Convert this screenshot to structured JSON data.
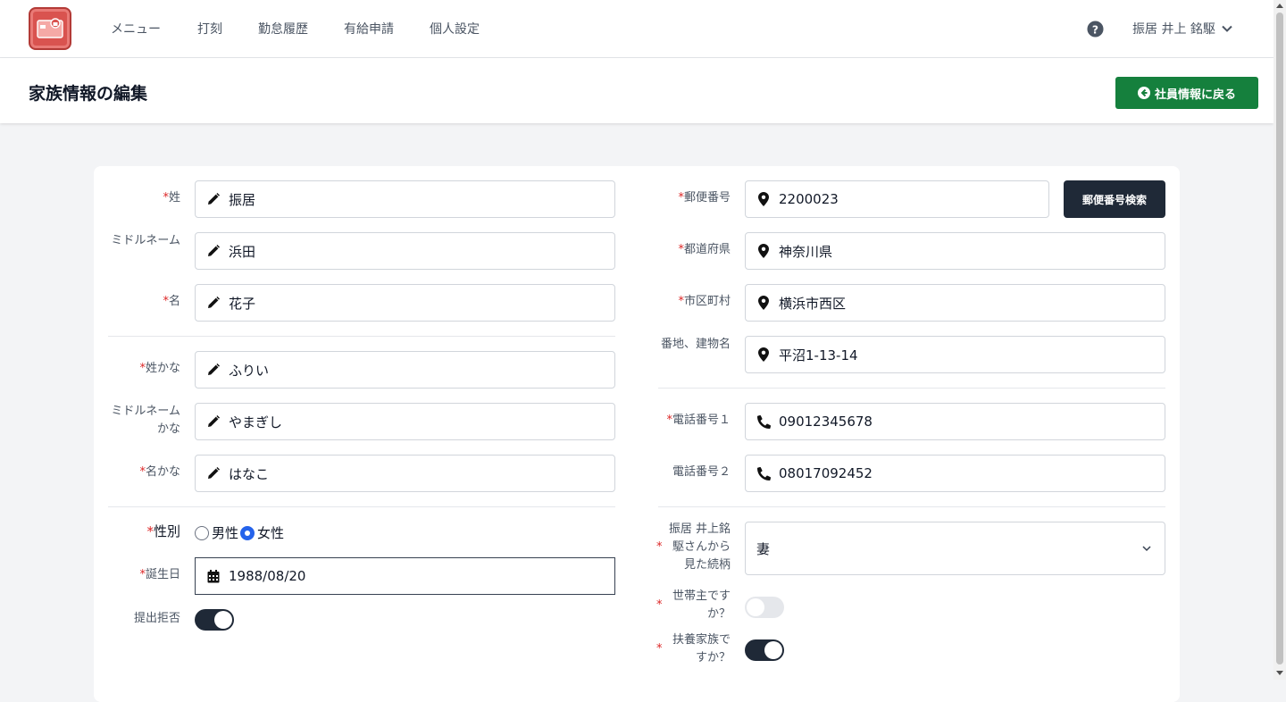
{
  "nav": {
    "items": [
      "メニュー",
      "打刻",
      "勤怠履歴",
      "有給申請",
      "個人設定"
    ],
    "user_name": "振居 井上 銘駆"
  },
  "header": {
    "title": "家族情報の編集",
    "back_button": "社員情報に戻る"
  },
  "colors": {
    "accent_green": "#15803d",
    "dark": "#1f2937",
    "required": "#dc2626",
    "logo": "#d9534f"
  },
  "form": {
    "required_mark": "*",
    "last_name": {
      "label": "姓",
      "value": "振居",
      "icon": "pencil-icon"
    },
    "middle_name": {
      "label": "ミドルネーム",
      "value": "浜田",
      "icon": "pencil-icon"
    },
    "first_name": {
      "label": "名",
      "value": "花子",
      "icon": "pencil-icon"
    },
    "last_name_kana": {
      "label": "姓かな",
      "value": "ふりい",
      "icon": "pencil-icon"
    },
    "middle_name_kana": {
      "label": "ミドルネームかな",
      "value": "やまぎし",
      "icon": "pencil-icon"
    },
    "first_name_kana": {
      "label": "名かな",
      "value": "はなこ",
      "icon": "pencil-icon"
    },
    "gender": {
      "label": "性別",
      "options": [
        "男性",
        "女性"
      ],
      "selected": "女性"
    },
    "birthday": {
      "label": "誕生日",
      "value": "1988/08/20",
      "icon": "calendar-icon"
    },
    "refuse_submit": {
      "label": "提出拒否",
      "on": true
    },
    "postal_code": {
      "label": "郵便番号",
      "value": "2200023",
      "icon": "map-pin-icon",
      "search_button": "郵便番号検索"
    },
    "prefecture": {
      "label": "都道府県",
      "value": "神奈川県",
      "icon": "map-pin-icon"
    },
    "city": {
      "label": "市区町村",
      "value": "横浜市西区",
      "icon": "map-pin-icon"
    },
    "address": {
      "label": "番地、建物名",
      "value": "平沼1-13-14",
      "icon": "map-pin-icon"
    },
    "phone1": {
      "label": "電話番号１",
      "value": "09012345678",
      "icon": "phone-icon"
    },
    "phone2": {
      "label": "電話番号２",
      "value": "08017092452",
      "icon": "phone-icon"
    },
    "relation": {
      "label": "振居 井上銘駆さんから見た続柄",
      "value": "妻"
    },
    "household_head": {
      "label": "世帯主ですか？",
      "on": false
    },
    "dependent": {
      "label": "扶養家族ですか？",
      "on": true
    }
  }
}
